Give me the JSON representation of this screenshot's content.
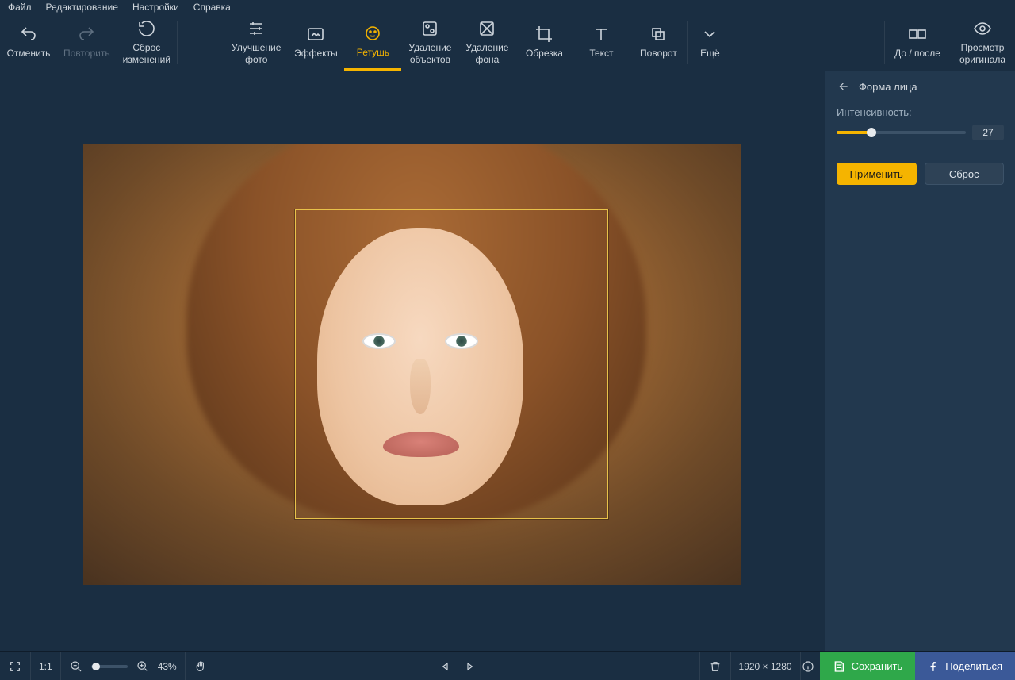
{
  "menu": [
    "Файл",
    "Редактирование",
    "Настройки",
    "Справка"
  ],
  "toolbar": {
    "undo": "Отменить",
    "redo": "Повторить",
    "reset": "Сброс\nизменений",
    "enhance": "Улучшение\nфото",
    "effects": "Эффекты",
    "retouch": "Ретушь",
    "remove_obj": "Удаление\nобъектов",
    "remove_bg": "Удаление\nфона",
    "crop": "Обрезка",
    "text": "Текст",
    "rotate": "Поворот",
    "more": "Ещё",
    "before_after": "До / после",
    "view_orig": "Просмотр\nоригинала"
  },
  "panel": {
    "title": "Форма лица",
    "intensity_label": "Интенсивность:",
    "intensity_value": "27",
    "apply": "Применить",
    "reset": "Сброс"
  },
  "status": {
    "fit_label": "1:1",
    "zoom": "43%",
    "dimensions": "1920 × 1280",
    "save": "Сохранить",
    "share": "Поделиться"
  },
  "colors": {
    "accent": "#f5b400",
    "save": "#2fa84a",
    "share": "#3b5998"
  }
}
